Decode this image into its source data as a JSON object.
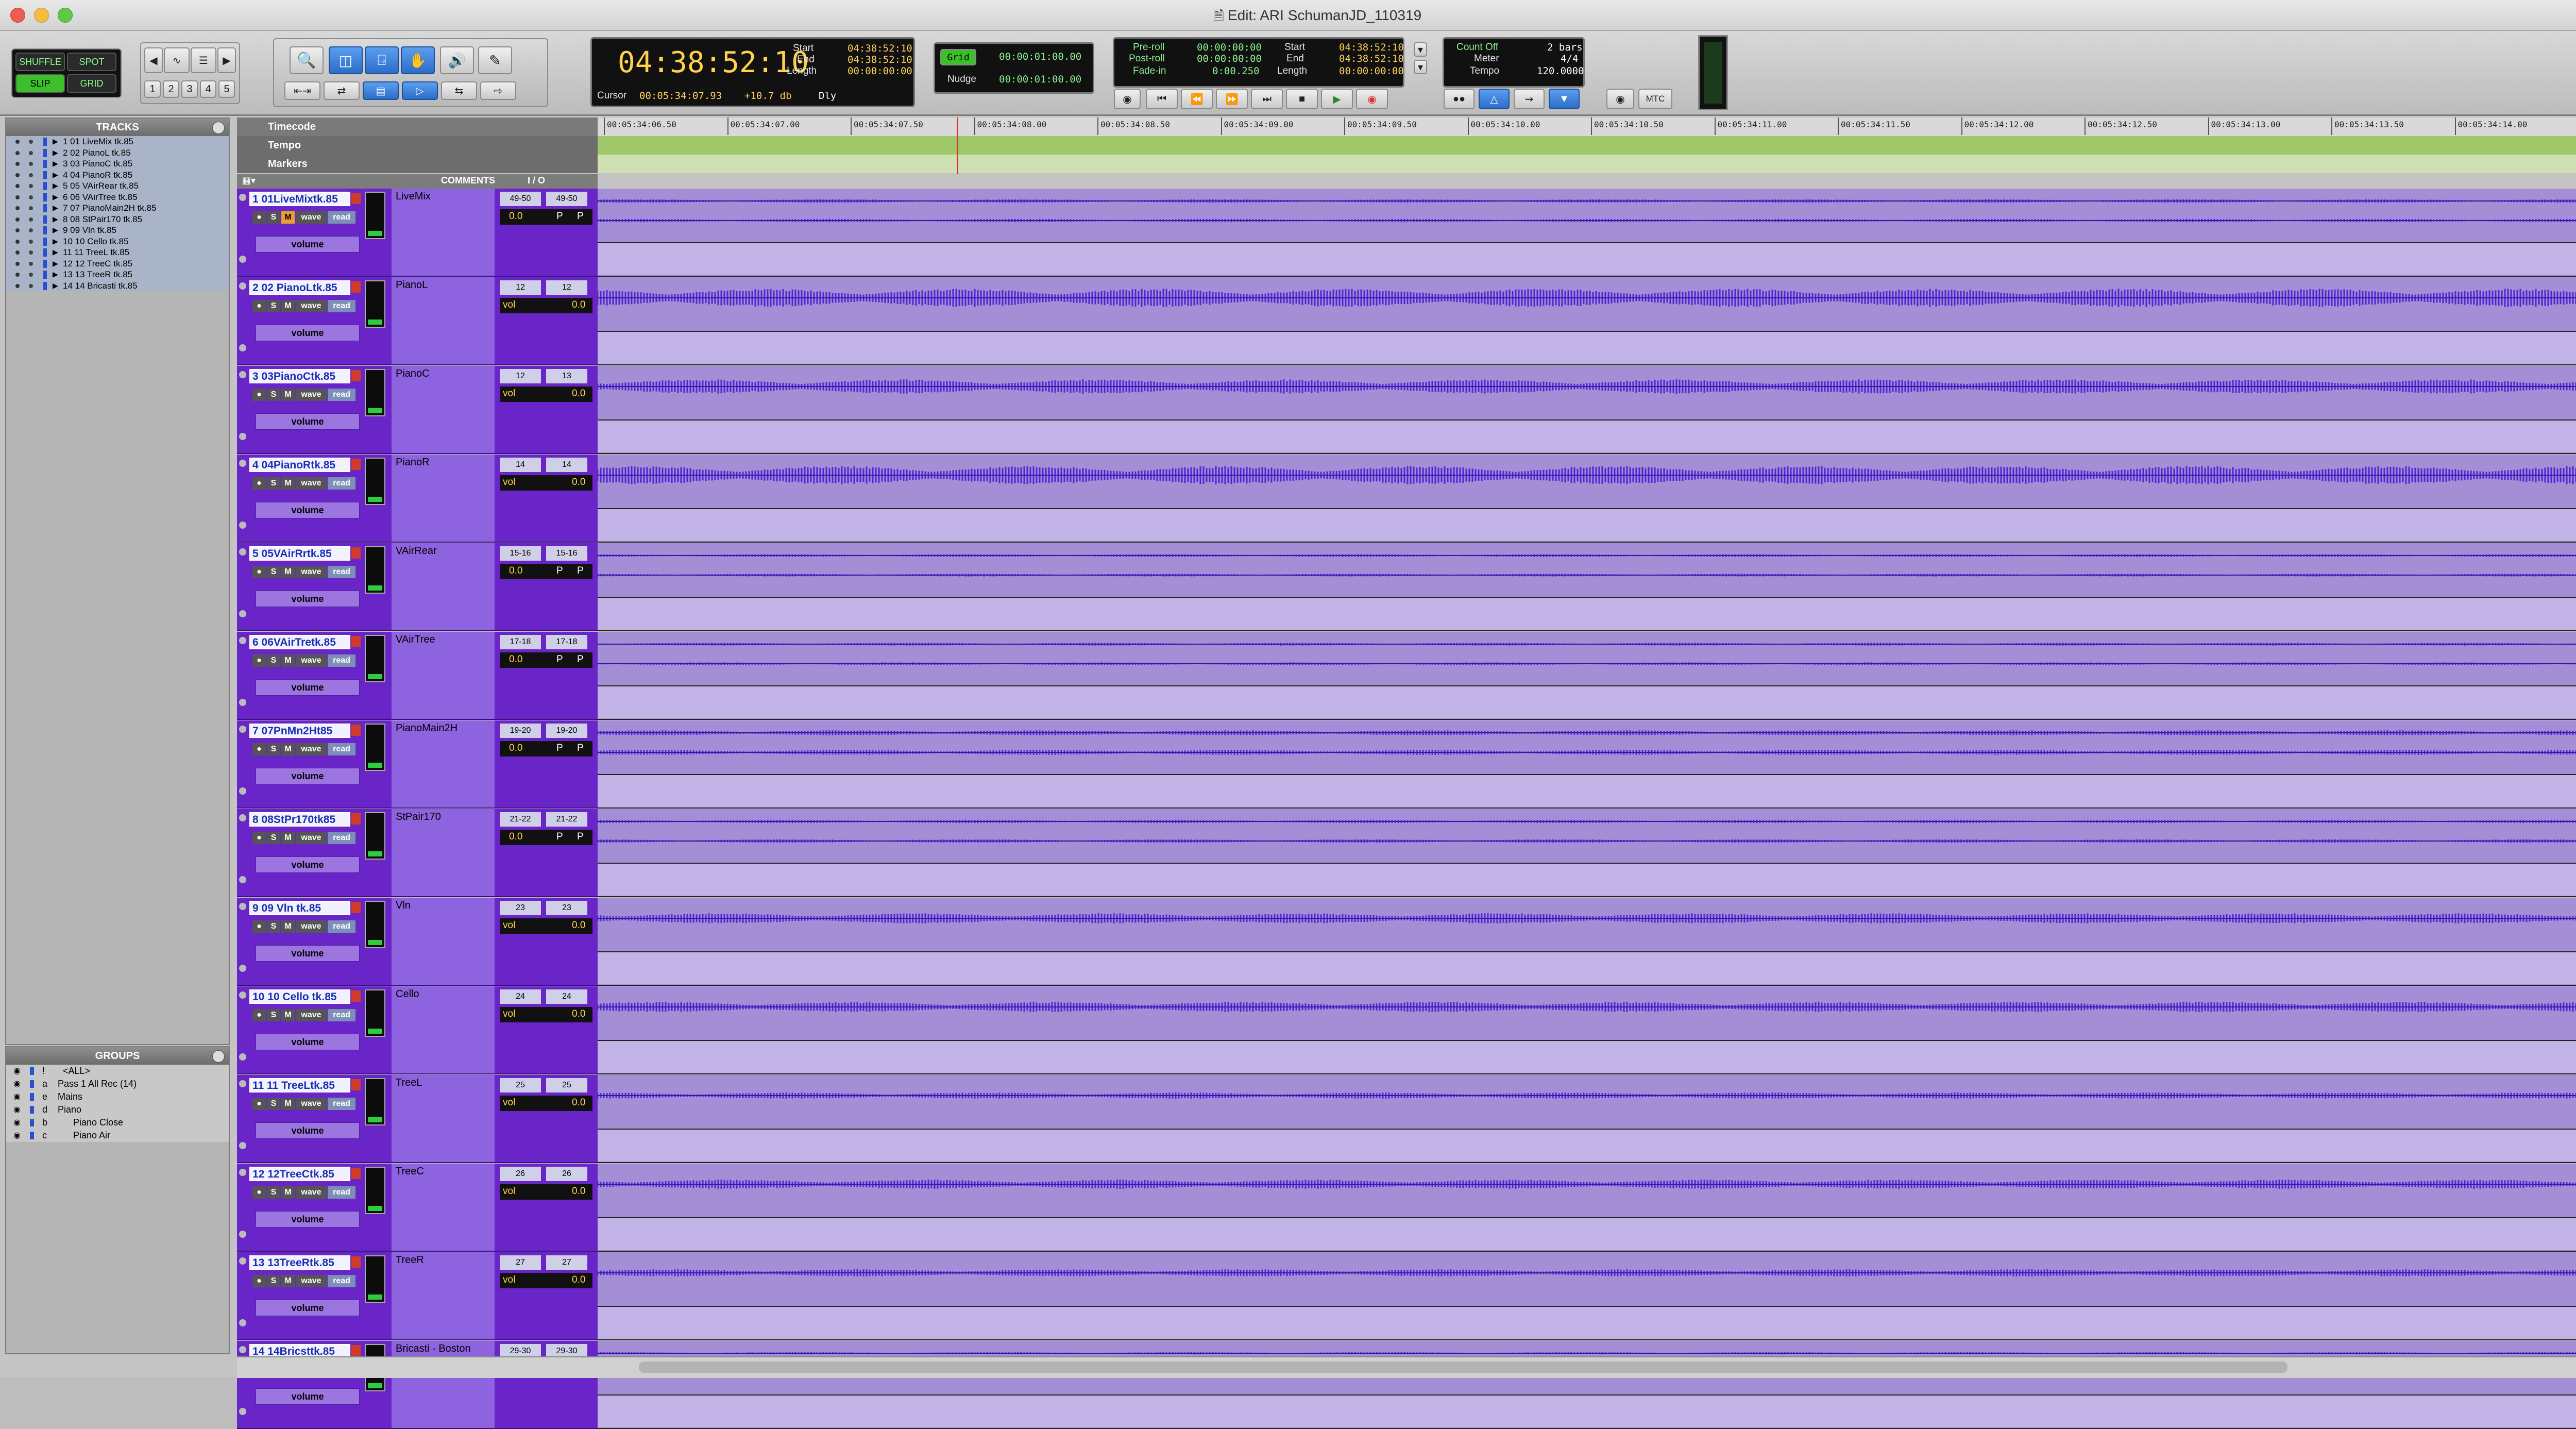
{
  "window": {
    "title": "Edit: ARI SchumanJD_110319"
  },
  "modes": {
    "shuffle": "SHUFFLE",
    "spot": "SPOT",
    "slip": "SLIP",
    "grid": "GRID"
  },
  "zoom_presets": [
    "1",
    "2",
    "3",
    "4",
    "5"
  ],
  "main_counter": "04:38:52:10",
  "selection": {
    "start_label": "Start",
    "end_label": "End",
    "length_label": "Length",
    "start": "04:38:52:10",
    "end": "04:38:52:10",
    "length": "00:00:00:00"
  },
  "cursor": {
    "label": "Cursor",
    "value": "00:05:34:07.93",
    "offset": "+10.7 db",
    "dly": "Dly"
  },
  "grid": {
    "label": "Grid",
    "value": "00:00:01:00.00"
  },
  "nudge": {
    "label": "Nudge",
    "value": "00:00:01:00.00"
  },
  "preroll": {
    "pre_label": "Pre-roll",
    "post_label": "Post-roll",
    "fade_label": "Fade-in",
    "pre": "00:00:00:00",
    "post": "00:00:00:00",
    "fade": "0:00.250"
  },
  "transport_sel": {
    "start_label": "Start",
    "end_label": "End",
    "length_label": "Length",
    "start": "04:38:52:10",
    "end": "04:38:52:10",
    "length": "00:00:00:00"
  },
  "meter": {
    "countoff": "Count Off",
    "bars": "2 bars",
    "meter_label": "Meter",
    "meter": "4/4",
    "tempo_label": "Tempo",
    "tempo": "120.0000"
  },
  "mtc": "MTC",
  "tracks_pane": {
    "title": "TRACKS",
    "items": [
      "1  01 LiveMix tk.85",
      "2  02 PianoL tk.85",
      "3  03 PianoC tk.85",
      "4  04 PianoR tk.85",
      "5  05 VAirRear tk.85",
      "6  06 VAirTree tk.85",
      "7  07 PianoMain2H tk.85",
      "8  08 StPair170 tk.85",
      "9  09 Vln tk.85",
      "10  10 Cello tk.85",
      "11  11 TreeL tk.85",
      "12  12 TreeC tk.85",
      "13  13 TreeR tk.85",
      "14  14 Bricasti tk.85"
    ]
  },
  "groups_pane": {
    "title": "GROUPS",
    "items": [
      {
        "id": "!",
        "name": "<ALL>"
      },
      {
        "id": "a",
        "name": "Pass 1 All Rec (14)"
      },
      {
        "id": "e",
        "name": "Mains"
      },
      {
        "id": "d",
        "name": "Piano"
      },
      {
        "id": "b",
        "name": "Piano Close"
      },
      {
        "id": "c",
        "name": "Piano Air"
      }
    ]
  },
  "rulers": {
    "timecode": "Timecode",
    "tempo": "Tempo",
    "markers": "Markers"
  },
  "timeline_ticks": [
    "00:05:34:06.50",
    "00:05:34:07.00",
    "00:05:34:07.50",
    "00:05:34:08.00",
    "00:05:34:08.50",
    "00:05:34:09.00",
    "00:05:34:09.50",
    "00:05:34:10.00",
    "00:05:34:10.50",
    "00:05:34:11.00",
    "00:05:34:11.50",
    "00:05:34:12.00",
    "00:05:34:12.50",
    "00:05:34:13.00",
    "00:05:34:13.50",
    "00:05:34:14.00"
  ],
  "edit_header": {
    "comments": "COMMENTS",
    "io": "I / O"
  },
  "track_buttons": {
    "rec": "●",
    "solo": "S",
    "mute": "M",
    "view": "wave",
    "auto": "read",
    "vol_label": "volume"
  },
  "tracks": [
    {
      "name": "1  01LiveMixtk.85",
      "comment": "LiveMix",
      "in": "49-50",
      "out": "49-50",
      "vol_label": "",
      "vol": "0.0",
      "pan": "P"
    },
    {
      "name": "2  02 PianoLtk.85",
      "comment": "PianoL",
      "in": "12",
      "out": "12",
      "vol_label": "vol",
      "vol": "0.0"
    },
    {
      "name": "3  03PianoCtk.85",
      "comment": "PianoC",
      "in": "12",
      "out": "13",
      "vol_label": "vol",
      "vol": "0.0"
    },
    {
      "name": "4  04PianoRtk.85",
      "comment": "PianoR",
      "in": "14",
      "out": "14",
      "vol_label": "vol",
      "vol": "0.0"
    },
    {
      "name": "5  05VAirRrtk.85",
      "comment": "VAirRear",
      "in": "15-16",
      "out": "15-16",
      "vol_label": "",
      "vol": "0.0",
      "pan": "P"
    },
    {
      "name": "6  06VAirTretk.85",
      "comment": "VAirTree",
      "in": "17-18",
      "out": "17-18",
      "vol_label": "",
      "vol": "0.0",
      "pan": "P"
    },
    {
      "name": "7  07PnMn2Ht85",
      "comment": "PianoMain2H",
      "in": "19-20",
      "out": "19-20",
      "vol_label": "",
      "vol": "0.0",
      "pan": "P"
    },
    {
      "name": "8  08StPr170tk85",
      "comment": "StPair170",
      "in": "21-22",
      "out": "21-22",
      "vol_label": "",
      "vol": "0.0",
      "pan": "P"
    },
    {
      "name": "9  09 Vln tk.85",
      "comment": "Vln",
      "in": "23",
      "out": "23",
      "vol_label": "vol",
      "vol": "0.0"
    },
    {
      "name": "10 10 Cello tk.85",
      "comment": "Cello",
      "in": "24",
      "out": "24",
      "vol_label": "vol",
      "vol": "0.0"
    },
    {
      "name": "11 11 TreeLtk.85",
      "comment": "TreeL",
      "in": "25",
      "out": "25",
      "vol_label": "vol",
      "vol": "0.0"
    },
    {
      "name": "12 12TreeCtk.85",
      "comment": "TreeC",
      "in": "26",
      "out": "26",
      "vol_label": "vol",
      "vol": "0.0"
    },
    {
      "name": "13 13TreeRtk.85",
      "comment": "TreeR",
      "in": "27",
      "out": "27",
      "vol_label": "vol",
      "vol": "0.0"
    },
    {
      "name": "14 14Bricsttk.85",
      "comment": "Bricasti - Boston",
      "in": "29-30",
      "out": "29-30",
      "vol_label": "",
      "vol": "",
      "pan": ""
    }
  ],
  "colors": {
    "track_purple": "#6a25c8",
    "waveform": "#5224d4",
    "lane": "#a48ed6",
    "tempo_green": "#9ec86a"
  }
}
